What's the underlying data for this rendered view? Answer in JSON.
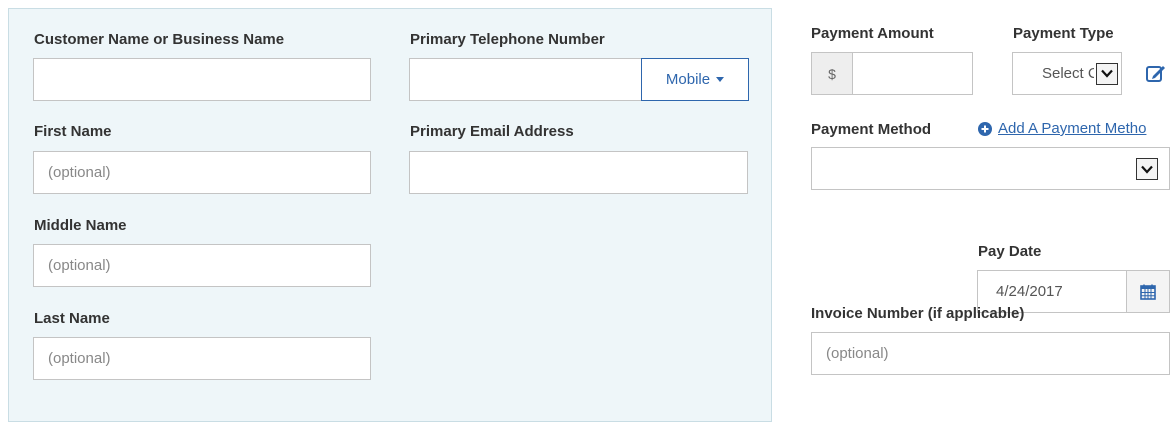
{
  "customer_form": {
    "customer_name": {
      "label": "Customer Name or Business Name",
      "value": "",
      "placeholder": ""
    },
    "phone": {
      "label": "Primary Telephone Number",
      "value": "",
      "placeholder": "",
      "type_button": "Mobile"
    },
    "first_name": {
      "label": "First Name",
      "placeholder": "(optional)"
    },
    "email": {
      "label": "Primary Email Address",
      "value": "",
      "placeholder": ""
    },
    "middle_name": {
      "label": "Middle Name",
      "placeholder": "(optional)"
    },
    "last_name": {
      "label": "Last Name",
      "placeholder": "(optional)"
    }
  },
  "payment": {
    "amount": {
      "label": "Payment Amount",
      "currency_symbol": "$",
      "value": ""
    },
    "type": {
      "label": "Payment Type",
      "selected": "Select C"
    },
    "method": {
      "label": "Payment Method",
      "add_link": "Add A Payment Metho",
      "selected": ""
    },
    "pay_date": {
      "label": "Pay Date",
      "value": "4/24/2017"
    },
    "invoice": {
      "label": "Invoice Number (if applicable)",
      "placeholder": "(optional)"
    }
  },
  "colors": {
    "panel_bg": "#eef6f9",
    "accent": "#2e66ad",
    "border": "#c4c4c4"
  }
}
